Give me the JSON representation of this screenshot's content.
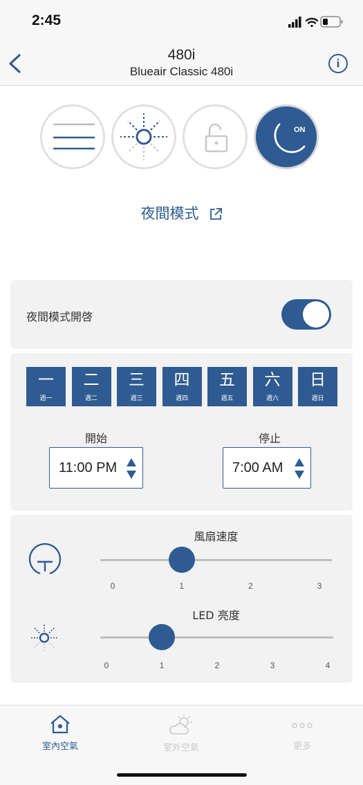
{
  "status_bar": {
    "time": "2:45"
  },
  "header": {
    "title": "480i",
    "subtitle": "Blueair Classic 480i"
  },
  "modes": {
    "items": [
      {
        "name": "fan-speed-mode",
        "icon": "fan-lines-icon",
        "active": false
      },
      {
        "name": "led-brightness-mode",
        "icon": "sun-icon",
        "active": false
      },
      {
        "name": "child-lock-mode",
        "icon": "unlock-icon",
        "active": false
      },
      {
        "name": "night-mode",
        "icon": "moon-icon",
        "active": true,
        "badge": "ON"
      }
    ],
    "title": "夜間模式"
  },
  "night_mode": {
    "toggle_label": "夜間模式開啓",
    "enabled": true
  },
  "schedule": {
    "days": [
      {
        "char": "一",
        "sub": "週一"
      },
      {
        "char": "二",
        "sub": "週二"
      },
      {
        "char": "三",
        "sub": "週三"
      },
      {
        "char": "四",
        "sub": "週四"
      },
      {
        "char": "五",
        "sub": "週五"
      },
      {
        "char": "六",
        "sub": "週六"
      },
      {
        "char": "日",
        "sub": "週日"
      }
    ],
    "start_label": "開始",
    "start_value": "11:00 PM",
    "stop_label": "停止",
    "stop_value": "7:00 AM"
  },
  "fan_speed": {
    "title": "風扇速度",
    "ticks": [
      "0",
      "1",
      "2",
      "3"
    ],
    "value": 1
  },
  "led": {
    "title": "LED 亮度",
    "ticks": [
      "0",
      "1",
      "2",
      "3",
      "4"
    ],
    "value": 1
  },
  "tabs": [
    {
      "label": "室內空氣",
      "icon": "home-icon",
      "active": true
    },
    {
      "label": "室外空氣",
      "icon": "weather-icon",
      "active": false
    },
    {
      "label": "更多",
      "icon": "more-dots-icon",
      "active": false
    }
  ],
  "colors": {
    "accent": "#2e5b91",
    "inactive": "#c8c8c8"
  }
}
